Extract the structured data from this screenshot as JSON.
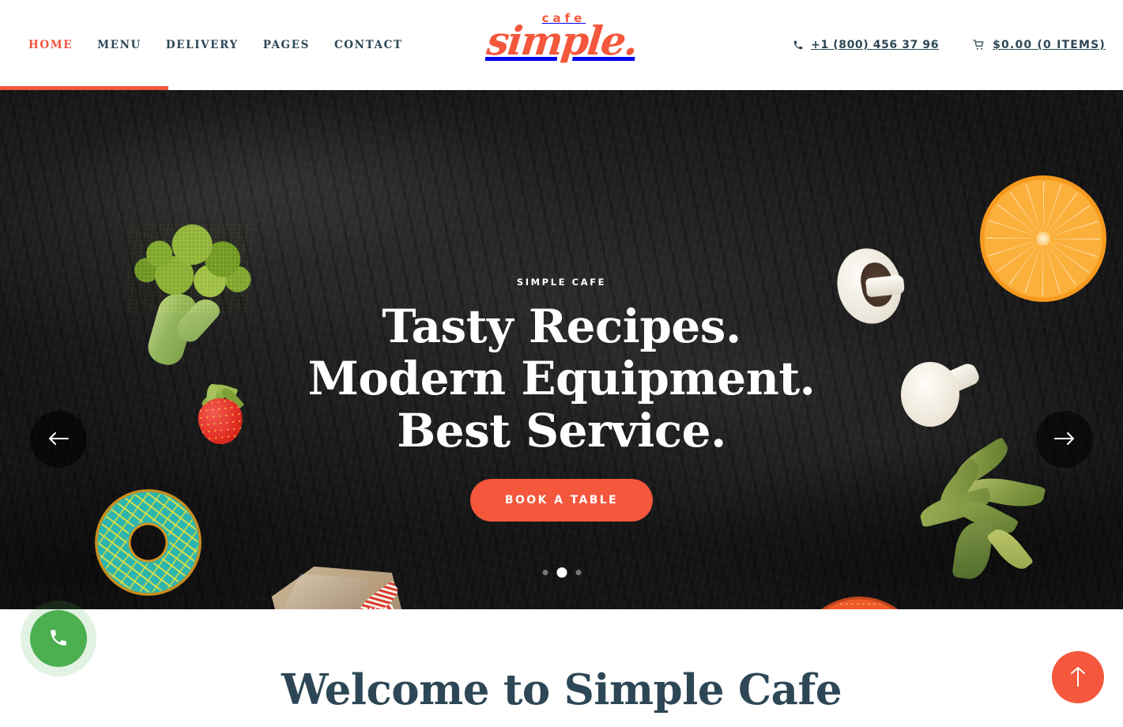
{
  "header": {
    "nav": [
      {
        "label": "HOME",
        "active": true
      },
      {
        "label": "MENU",
        "active": false
      },
      {
        "label": "DELIVERY",
        "active": false
      },
      {
        "label": "PAGES",
        "active": false
      },
      {
        "label": "CONTACT",
        "active": false
      }
    ],
    "logo": {
      "top": "cafe",
      "main": "simple."
    },
    "phone": "+1 (800) 456 37 96",
    "cart": "$0.00 (0 ITEMS)",
    "icons": {
      "phone": "phone-icon",
      "cart": "cart-icon"
    },
    "progress_percent": 15
  },
  "hero": {
    "subtitle": "SIMPLE CAFE",
    "title": "Tasty Recipes. Modern Equipment. Best Service.",
    "cta_label": "BOOK A TABLE",
    "prev_label": "Previous slide",
    "next_label": "Next slide",
    "slides_total": 3,
    "slide_active": 2,
    "dot_labels": [
      "Slide 1",
      "Slide 2",
      "Slide 3"
    ]
  },
  "floating": {
    "call_label": "Call us",
    "to_top_label": "Scroll to top"
  },
  "welcome": {
    "title": "Welcome to Simple Cafe"
  },
  "colors": {
    "accent": "#f4573c",
    "nav_text": "#2e4756",
    "hero_bg": "#141414",
    "call_green": "#4caf50",
    "white": "#ffffff"
  }
}
